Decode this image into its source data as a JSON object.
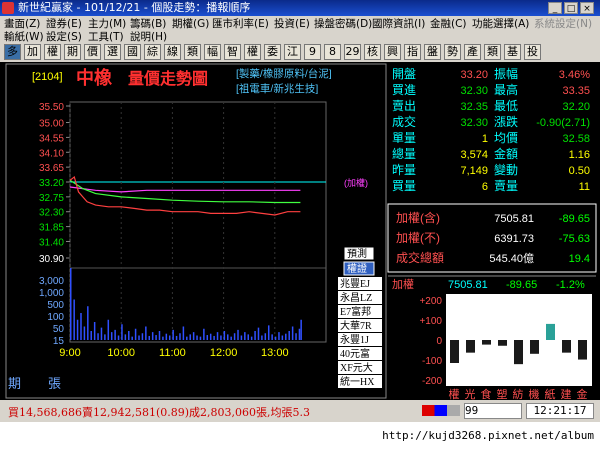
{
  "window": {
    "title": "新世紀贏家 - 101/12/21 - 個股走勢：播報順序",
    "buttons": [
      "_",
      "□",
      "×"
    ]
  },
  "menu": {
    "row1": [
      "畫面(Z)",
      "證券(E)",
      "主力(M)",
      "籌碼(B)",
      "期權(G)",
      "匯市利率(E)",
      "投資(E)",
      "操盤密碼(D)",
      "國際資訊(I)",
      "金融(C)",
      "功能選擇(A)",
      "系統設定(N)"
    ],
    "row2": [
      "輸紙(W)",
      "設定(S)",
      "工具(T)",
      "說明(H)"
    ]
  },
  "toolbar": {
    "buttons": [
      "多",
      "加",
      "權",
      "期",
      "價",
      "選",
      "國",
      "綜",
      "線",
      "類",
      "幅",
      "智",
      "權",
      "委",
      "江",
      "9",
      "8",
      "29",
      "核",
      "興",
      "指",
      "盤",
      "勢",
      "產",
      "類",
      "基",
      "投"
    ]
  },
  "stock": {
    "code": "[2104]",
    "name": "中橡",
    "chart_title": "量價走勢圖",
    "tags_line1": "[製藥/橡膠原料/台泥]",
    "tags_line2": "[祖電車/新兆生技]",
    "right_label": "(加權)"
  },
  "quote": {
    "rows": [
      {
        "l1": "開盤",
        "v1": "33.20",
        "l2": "振幅",
        "v2": "3.46%",
        "c1": "#ff5050",
        "c2": "#ff5050"
      },
      {
        "l1": "買進",
        "v1": "32.30",
        "l2": "最高",
        "v2": "33.35",
        "c1": "#00e000",
        "c2": "#ff5050"
      },
      {
        "l1": "賣出",
        "v1": "32.35",
        "l2": "最低",
        "v2": "32.20",
        "c1": "#00e000",
        "c2": "#00e000"
      },
      {
        "l1": "成交",
        "v1": "32.30",
        "l2": "漲跌",
        "v2": "-0.90(2.71)",
        "c1": "#00e000",
        "c2": "#00e000"
      },
      {
        "l1": "單量",
        "v1": "1",
        "l2": "均價",
        "v2": "32.58",
        "c1": "#ffff00",
        "c2": "#00e000"
      },
      {
        "l1": "總量",
        "v1": "3,574",
        "l2": "金額",
        "v2": "1.16",
        "c1": "#ffff00",
        "c2": "#ffff00"
      },
      {
        "l1": "昨量",
        "v1": "7,149",
        "l2": "變動",
        "v2": "0.50",
        "c1": "#ffff00",
        "c2": "#ffff00"
      },
      {
        "l1": "買量",
        "v1": "6",
        "l2": "賣量",
        "v2": "11",
        "c1": "#ffff00",
        "c2": "#ffff00"
      }
    ]
  },
  "index": {
    "rows": [
      {
        "label": "加權(含)",
        "value": "7505.81",
        "change": "-89.65"
      },
      {
        "label": "加權(不)",
        "value": "6391.73",
        "change": "-75.63"
      },
      {
        "label": "成交總額",
        "value": "545.40億",
        "change": "19.4"
      }
    ],
    "summary_label": "加權",
    "summary_value": "7505.81",
    "summary_change": "-89.65",
    "summary_pct": "-1.2%"
  },
  "sector": {
    "ticks": [
      "+200",
      "+100",
      "0",
      "-100",
      "-200"
    ],
    "labels": [
      "權",
      "光",
      "食",
      "塑",
      "紡",
      "機",
      "紙",
      "建",
      "金"
    ],
    "values": [
      -100,
      -55,
      -20,
      -25,
      -105,
      -60,
      70,
      -55,
      -85
    ],
    "colors": [
      "#1a1a1a",
      "#1a1a1a",
      "#1a1a1a",
      "#1a1a1a",
      "#1a1a1a",
      "#1a1a1a",
      "#2aa198",
      "#1a1a1a",
      "#1a1a1a"
    ]
  },
  "broker": {
    "tabs": [
      "預測",
      "權證"
    ],
    "list": [
      "兆豐EJ",
      "永昌LZ",
      "E7富邦",
      "大華7R",
      "永豐1J",
      "40元富",
      "XF元大",
      "統一HX"
    ]
  },
  "chart_data": {
    "type": "line",
    "y_ticks": [
      "35.50",
      "35.00",
      "34.55",
      "34.10",
      "33.65",
      "33.20",
      "32.75",
      "32.30",
      "31.85",
      "31.40",
      "30.90"
    ],
    "y_tick_colors": [
      "#ff5050",
      "#ff5050",
      "#ff5050",
      "#ff5050",
      "#ff5050",
      "#00e000",
      "#00e000",
      "#00e000",
      "#00e000",
      "#00e000",
      "#ffffff"
    ],
    "ref_price": 33.2,
    "ylim": [
      30.9,
      35.5
    ],
    "x_ticks": [
      "9:00",
      "10:00",
      "11:00",
      "12:00",
      "13:00"
    ],
    "x_label": "張",
    "period_label": "期",
    "vol_ticks": [
      "3,000",
      "1,000",
      "500",
      "100",
      "50",
      "15"
    ],
    "price_series": [
      [
        0,
        33.25
      ],
      [
        5,
        33.35
      ],
      [
        10,
        32.9
      ],
      [
        15,
        32.75
      ],
      [
        20,
        32.6
      ],
      [
        30,
        32.5
      ],
      [
        45,
        32.45
      ],
      [
        60,
        32.45
      ],
      [
        75,
        32.4
      ],
      [
        90,
        32.35
      ],
      [
        105,
        32.35
      ],
      [
        120,
        32.3
      ],
      [
        135,
        32.3
      ],
      [
        150,
        32.3
      ],
      [
        165,
        32.25
      ],
      [
        180,
        32.25
      ],
      [
        195,
        32.25
      ],
      [
        210,
        32.3
      ],
      [
        225,
        32.25
      ],
      [
        240,
        32.2
      ],
      [
        255,
        32.3
      ],
      [
        270,
        32.3
      ]
    ],
    "avg_series": [
      [
        0,
        33.25
      ],
      [
        15,
        33.0
      ],
      [
        30,
        32.85
      ],
      [
        60,
        32.75
      ],
      [
        90,
        32.7
      ],
      [
        120,
        32.65
      ],
      [
        150,
        32.62
      ],
      [
        180,
        32.6
      ],
      [
        210,
        32.6
      ],
      [
        240,
        32.58
      ],
      [
        270,
        32.58
      ]
    ],
    "index_series": [
      [
        0,
        33.05
      ],
      [
        30,
        32.95
      ],
      [
        60,
        32.9
      ],
      [
        90,
        32.95
      ],
      [
        120,
        32.95
      ],
      [
        150,
        32.95
      ],
      [
        180,
        32.95
      ],
      [
        210,
        32.95
      ],
      [
        240,
        32.95
      ],
      [
        270,
        32.95
      ]
    ],
    "volume": [
      [
        0,
        320
      ],
      [
        4,
        180
      ],
      [
        8,
        90
      ],
      [
        12,
        120
      ],
      [
        16,
        60
      ],
      [
        20,
        150
      ],
      [
        24,
        40
      ],
      [
        28,
        80
      ],
      [
        32,
        30
      ],
      [
        36,
        55
      ],
      [
        40,
        25
      ],
      [
        44,
        90
      ],
      [
        48,
        35
      ],
      [
        52,
        45
      ],
      [
        56,
        20
      ],
      [
        60,
        70
      ],
      [
        64,
        25
      ],
      [
        68,
        40
      ],
      [
        72,
        15
      ],
      [
        76,
        50
      ],
      [
        80,
        20
      ],
      [
        84,
        30
      ],
      [
        88,
        60
      ],
      [
        92,
        18
      ],
      [
        96,
        35
      ],
      [
        100,
        22
      ],
      [
        104,
        40
      ],
      [
        108,
        15
      ],
      [
        112,
        28
      ],
      [
        116,
        20
      ],
      [
        120,
        45
      ],
      [
        124,
        18
      ],
      [
        128,
        30
      ],
      [
        132,
        60
      ],
      [
        136,
        15
      ],
      [
        140,
        25
      ],
      [
        144,
        35
      ],
      [
        148,
        20
      ],
      [
        152,
        15
      ],
      [
        156,
        50
      ],
      [
        160,
        22
      ],
      [
        164,
        28
      ],
      [
        168,
        18
      ],
      [
        172,
        35
      ],
      [
        176,
        20
      ],
      [
        180,
        40
      ],
      [
        184,
        25
      ],
      [
        188,
        15
      ],
      [
        192,
        30
      ],
      [
        196,
        45
      ],
      [
        200,
        20
      ],
      [
        204,
        35
      ],
      [
        208,
        25
      ],
      [
        212,
        15
      ],
      [
        216,
        40
      ],
      [
        220,
        55
      ],
      [
        224,
        20
      ],
      [
        228,
        30
      ],
      [
        232,
        65
      ],
      [
        236,
        25
      ],
      [
        240,
        15
      ],
      [
        244,
        35
      ],
      [
        248,
        20
      ],
      [
        252,
        28
      ],
      [
        256,
        40
      ],
      [
        260,
        60
      ],
      [
        264,
        30
      ],
      [
        268,
        50
      ],
      [
        270,
        90
      ]
    ],
    "price_color": "#ff4040",
    "avg_color": "#40ff40",
    "index_color": "#ff40ff",
    "volume_color": "#3050ff",
    "ref_color": "#00ffff"
  },
  "status": {
    "text": "買14,568,686賣12,942,581(0.89)成2,803,060張,均張5.3",
    "page": "99",
    "time": "12:21:17"
  },
  "url": "http://kujd3268.pixnet.net/album"
}
